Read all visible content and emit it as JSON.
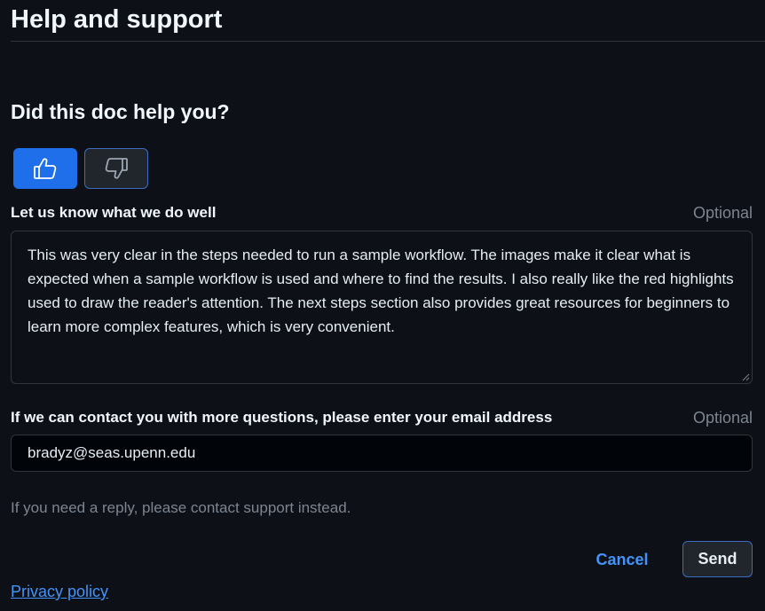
{
  "header": {
    "title": "Help and support"
  },
  "feedback": {
    "question": "Did this doc help you?",
    "thumbs_up_icon": "thumbs-up-icon",
    "thumbs_down_icon": "thumbs-down-icon",
    "selected": "thumbs-up",
    "accent_color": "#1f6feb"
  },
  "comment": {
    "label": "Let us know what we do well",
    "optional": "Optional",
    "value": "This was very clear in the steps needed to run a sample workflow. The images make it clear what is expected when a sample workflow is used and where to find the results. I also really like the red highlights used to draw the reader's attention. The next steps section also provides great resources for beginners to learn more complex features, which is very convenient."
  },
  "email": {
    "label": "If we can contact you with more questions, please enter your email address",
    "optional": "Optional",
    "value": "bradyz@seas.upenn.edu"
  },
  "hint": "If you need a reply, please contact support instead.",
  "actions": {
    "cancel": "Cancel",
    "send": "Send"
  },
  "footer": {
    "privacy": "Privacy policy"
  }
}
